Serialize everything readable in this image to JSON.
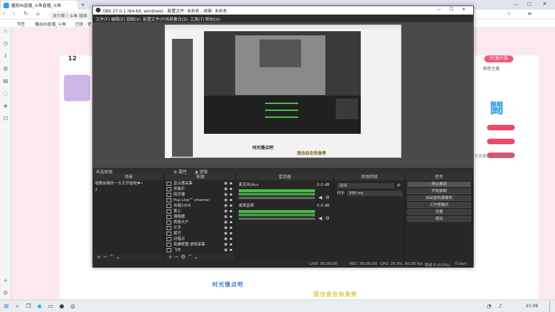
{
  "browser": {
    "tabs": [
      {
        "label": "播放IN直播_斗鱼直播_斗鱼",
        "active": true
      },
      {
        "label": "",
        "active": false
      }
    ],
    "address": "皮尔斯 | 斗鱼 搜索",
    "bookmarks": [
      "书签",
      "播出IN直播_斗鱼",
      "已版 - 使"
    ]
  },
  "page": {
    "count_label": "12",
    "right_link_1": "PC客户端",
    "right_text": "推荐主播",
    "side_text": "但真播看, 斗鱼直播是"
  },
  "obs": {
    "title": "OBS 27.0.1 (64-bit, windows) - 配置文件: 未命名 - 场景: 未命名",
    "menu": [
      "文件(F)",
      "编辑(E)",
      "视图(V)",
      "配置文件(P)",
      "场景集合(S)",
      "工具(T)",
      "帮助(H)"
    ],
    "scene_tabs": {
      "label": "未选择源",
      "props": "属性",
      "filters": "滤镜"
    },
    "docks": {
      "scenes": {
        "title": "场景",
        "items": [
          "唱歌前奏的一天又开始啦❤~",
          "2"
        ]
      },
      "sources": {
        "title": "来源",
        "items": [
          "显示器采集",
          "伴奏乐",
          "网页播",
          "Pop Live™ channel",
          "合唱1009",
          "爱心",
          "滑稽猪",
          "表情大户",
          "文字",
          "尾巴",
          "对唱点",
          "英雄联盟 游戏采集",
          "飞车"
        ]
      },
      "mixer": {
        "title": "混音器",
        "channels": [
          {
            "name": "麦克风/Aux",
            "db": "0.0 dB"
          },
          {
            "name": "桌面音频",
            "db": "0.0 dB"
          }
        ]
      },
      "transitions": {
        "title": "转场特效",
        "type": "淡出",
        "duration_label": "时长",
        "duration_value": "300 ms"
      },
      "controls": {
        "title": "控件",
        "buttons": [
          "停止推流",
          "开始录制",
          "启动虚拟摄像机",
          "工作室模式",
          "设置",
          "退出"
        ]
      }
    },
    "status": {
      "live": "LIVE: 00:00:00",
      "rec": "REC: 00:00:00",
      "cpu": "CPU: 26.3%, 60.00 fps",
      "dropped": "丢帧 0 (0.0%)",
      "kbps": "0 kb/s"
    },
    "nested_caption_1": "时光慢点吧",
    "nested_caption_2": "我也会在你身旁"
  },
  "lyrics": {
    "line1": "时光慢点吧",
    "line2": "我也会在你身旁"
  },
  "taskbar": {
    "time": "21:08"
  },
  "colors": {
    "accent": "#2aa0ea",
    "meter_green": "#49c24a",
    "lyric_blue": "#3a7bd5",
    "lyric_yellow": "#e0c23a"
  }
}
